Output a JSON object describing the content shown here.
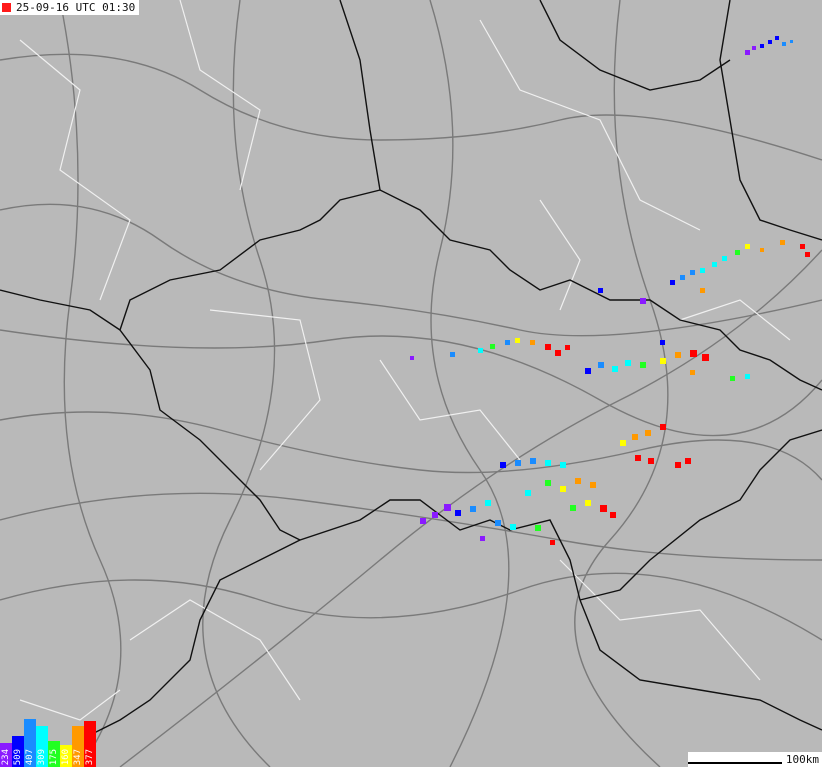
{
  "timestamp": "25-09-16 UTC 01:30",
  "scale_label": "100km",
  "colors": {
    "background": "#b9b9b9",
    "roads": "#7a7a7a",
    "borders_internal": "#f0f0f0",
    "borders_national": "#111111"
  },
  "legend": [
    {
      "value": "234",
      "color": "#8a1aff",
      "level": 0.5
    },
    {
      "value": "509",
      "color": "#0000ff",
      "level": 0.65
    },
    {
      "value": "407",
      "color": "#1a8cff",
      "level": 1.0
    },
    {
      "value": "309",
      "color": "#00ffff",
      "level": 0.85
    },
    {
      "value": "175",
      "color": "#22ff22",
      "level": 0.55
    },
    {
      "value": "160",
      "color": "#ffff00",
      "level": 0.45
    },
    {
      "value": "347",
      "color": "#ff9900",
      "level": 0.85
    },
    {
      "value": "377",
      "color": "#ff0000",
      "level": 0.95
    }
  ]
}
